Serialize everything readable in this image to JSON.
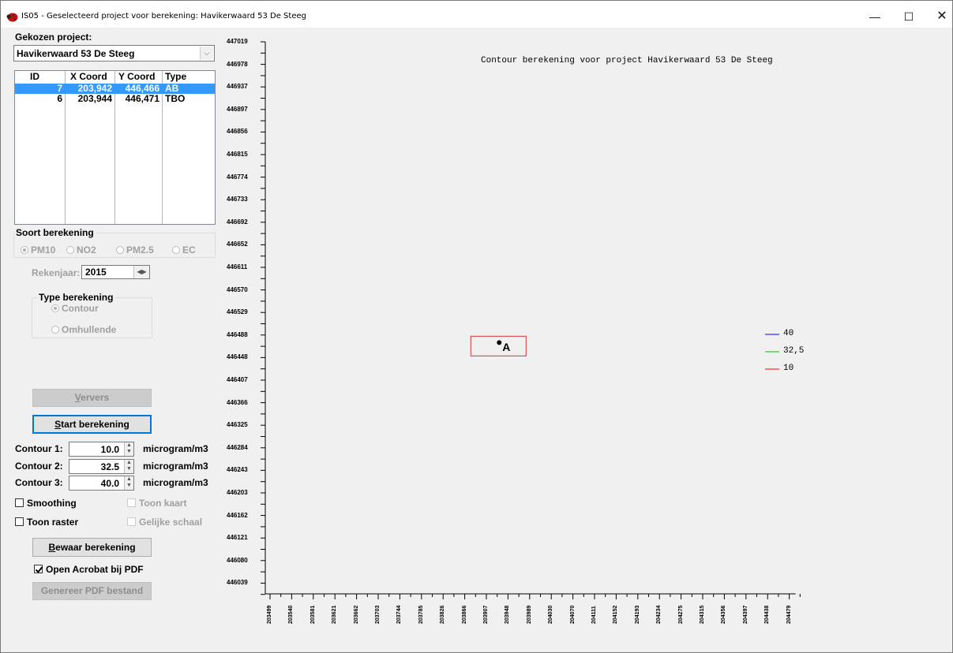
{
  "window": {
    "title": "IS05 - Geselecteerd project voor berekening: Havikerwaard 53 De Steeg",
    "controls": {
      "minimize": "—",
      "maximize": "☐",
      "close": "✕"
    }
  },
  "project": {
    "label": "Gekozen project:",
    "selected": "Havikerwaard 53 De Steeg"
  },
  "points_table": {
    "headers": [
      "ID",
      "X Coord",
      "Y Coord",
      "Type"
    ],
    "rows": [
      {
        "id": "7",
        "x": "203,942",
        "y": "446,466",
        "type": "AB",
        "selected": true
      },
      {
        "id": "6",
        "x": "203,944",
        "y": "446,471",
        "type": "TBO",
        "selected": false
      }
    ]
  },
  "soort": {
    "title": "Soort berekening",
    "options": [
      "PM10",
      "NO2",
      "PM2.5",
      "EC"
    ],
    "selected": "PM10"
  },
  "rekenjaar": {
    "label": "Rekenjaar:",
    "value": "2015"
  },
  "type_berekening": {
    "title": "Type berekening",
    "options": [
      "Contour",
      "Omhullende"
    ],
    "selected": "Contour"
  },
  "buttons": {
    "ververs_pre": "V",
    "ververs_rest": "ervers",
    "start_pre": "S",
    "start_rest": "tart berekening",
    "bewaar_pre": "B",
    "bewaar_rest": "ewaar berekening",
    "genereer": "Genereer PDF bestand"
  },
  "contours": [
    {
      "label": "Contour 1:",
      "value": "10.0",
      "unit": "microgram/m3"
    },
    {
      "label": "Contour 2:",
      "value": "32.5",
      "unit": "microgram/m3"
    },
    {
      "label": "Contour 3:",
      "value": "40.0",
      "unit": "microgram/m3"
    }
  ],
  "checkboxes": {
    "smoothing": {
      "label": "Smoothing",
      "checked": false
    },
    "toon_kaart": {
      "label": "Toon kaart",
      "checked": false
    },
    "toon_raster": {
      "label": "Toon raster",
      "checked": false
    },
    "gelijke_schaal": {
      "label": "Gelijke schaal",
      "checked": false
    },
    "open_acrobat": {
      "label": "Open Acrobat bij PDF",
      "checked": true
    }
  },
  "chart_data": {
    "type": "scatter",
    "title": "Contour berekening voor project Havikerwaard 53 De Steeg",
    "y_ticks": [
      "447019",
      "446978",
      "446937",
      "446897",
      "446856",
      "446815",
      "446774",
      "446733",
      "446692",
      "446652",
      "446611",
      "446570",
      "446529",
      "446488",
      "446448",
      "446407",
      "446366",
      "446325",
      "446284",
      "446243",
      "446203",
      "446162",
      "446121",
      "446080",
      "446039"
    ],
    "x_ticks": [
      "203499",
      "203540",
      "203581",
      "203621",
      "203662",
      "203703",
      "203744",
      "203785",
      "203826",
      "203866",
      "203907",
      "203948",
      "203989",
      "204030",
      "204070",
      "204111",
      "204152",
      "204193",
      "204234",
      "204275",
      "204315",
      "204356",
      "204397",
      "204438",
      "204479"
    ],
    "points": [
      {
        "x": 203942,
        "y": 446466,
        "label": "A"
      }
    ],
    "legend": [
      {
        "label": "40",
        "color": "#0000ff"
      },
      {
        "label": "32,5",
        "color": "#00c000"
      },
      {
        "label": "10",
        "color": "#ff0000"
      }
    ],
    "box_color": "#e03030"
  }
}
